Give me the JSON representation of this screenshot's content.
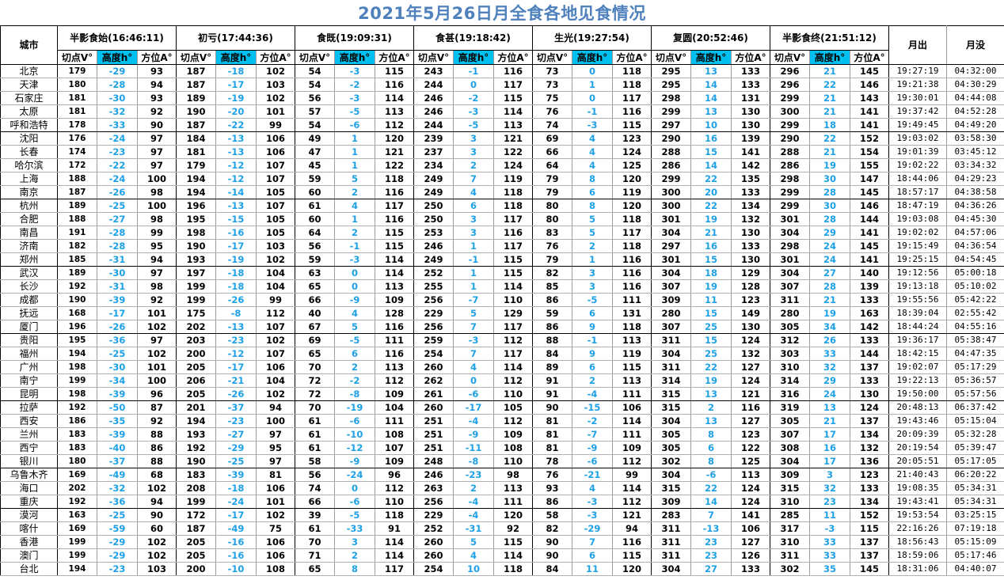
{
  "title": "2021年5月26日月全食各地见食情况",
  "headers": {
    "city": "城市",
    "phases": [
      "半影食始(16:46:11)",
      "初亏(17:44:36)",
      "食既(19:09:31)",
      "食甚(19:18:42)",
      "生光(19:27:54)",
      "复圆(20:52:46)",
      "半影食终(21:51:12)"
    ],
    "sub": [
      "切点V°",
      "高度h°",
      "方位A°"
    ],
    "moonrise": "月出",
    "moonset": "月没"
  },
  "colors": {
    "title": "#4f81bd",
    "height_text": "#1ea0e6",
    "height_header_bg": "#00c0f0"
  },
  "groups": [
    5,
    5,
    5,
    5,
    5,
    5,
    3
  ],
  "rows": [
    {
      "city": "北京",
      "vals": [
        179,
        -29,
        93,
        187,
        -18,
        102,
        54,
        -3,
        115,
        243,
        -1,
        116,
        73,
        0,
        118,
        295,
        13,
        133,
        296,
        21,
        145
      ],
      "rise": "19:27:19",
      "set": "04:32:00"
    },
    {
      "city": "天津",
      "vals": [
        180,
        -28,
        94,
        187,
        -17,
        103,
        54,
        -2,
        116,
        244,
        0,
        117,
        73,
        1,
        118,
        295,
        14,
        133,
        296,
        22,
        146
      ],
      "rise": "19:21:38",
      "set": "04:30:29"
    },
    {
      "city": "石家庄",
      "vals": [
        181,
        -30,
        93,
        189,
        -19,
        102,
        56,
        -3,
        114,
        246,
        -2,
        115,
        75,
        0,
        117,
        298,
        14,
        131,
        299,
        21,
        143
      ],
      "rise": "19:30:01",
      "set": "04:44:08"
    },
    {
      "city": "太原",
      "vals": [
        181,
        -32,
        92,
        190,
        -20,
        101,
        57,
        -5,
        113,
        246,
        -3,
        114,
        76,
        -1,
        116,
        299,
        13,
        130,
        300,
        21,
        141
      ],
      "rise": "19:37:42",
      "set": "04:52:28"
    },
    {
      "city": "呼和浩特",
      "vals": [
        178,
        -33,
        90,
        187,
        -22,
        99,
        54,
        -6,
        112,
        244,
        -5,
        113,
        74,
        -3,
        115,
        297,
        10,
        130,
        299,
        18,
        141
      ],
      "rise": "19:49:45",
      "set": "04:49:20"
    },
    {
      "city": "沈阳",
      "vals": [
        176,
        -24,
        97,
        184,
        -13,
        106,
        49,
        1,
        120,
        239,
        3,
        121,
        69,
        4,
        123,
        290,
        16,
        139,
        290,
        22,
        152
      ],
      "rise": "19:03:02",
      "set": "03:58:30"
    },
    {
      "city": "长春",
      "vals": [
        174,
        -23,
        97,
        181,
        -13,
        106,
        47,
        1,
        121,
        237,
        3,
        122,
        66,
        4,
        124,
        288,
        15,
        141,
        288,
        21,
        154
      ],
      "rise": "19:01:39",
      "set": "03:45:12"
    },
    {
      "city": "哈尔滨",
      "vals": [
        172,
        -22,
        97,
        179,
        -12,
        107,
        45,
        1,
        122,
        234,
        2,
        124,
        64,
        4,
        125,
        286,
        14,
        142,
        286,
        19,
        155
      ],
      "rise": "19:02:22",
      "set": "03:34:32"
    },
    {
      "city": "上海",
      "vals": [
        188,
        -24,
        100,
        194,
        -12,
        107,
        59,
        5,
        118,
        249,
        7,
        119,
        79,
        8,
        120,
        299,
        22,
        135,
        298,
        30,
        147
      ],
      "rise": "18:44:06",
      "set": "04:29:23"
    },
    {
      "city": "南京",
      "vals": [
        187,
        -26,
        98,
        194,
        -14,
        105,
        60,
        2,
        116,
        249,
        4,
        118,
        79,
        6,
        119,
        300,
        20,
        133,
        299,
        28,
        145
      ],
      "rise": "18:57:17",
      "set": "04:38:58"
    },
    {
      "city": "杭州",
      "vals": [
        189,
        -25,
        100,
        196,
        -13,
        107,
        61,
        4,
        117,
        250,
        6,
        118,
        80,
        8,
        120,
        300,
        22,
        134,
        299,
        30,
        146
      ],
      "rise": "18:47:19",
      "set": "04:36:26"
    },
    {
      "city": "合肥",
      "vals": [
        188,
        -27,
        98,
        195,
        -15,
        105,
        60,
        1,
        116,
        250,
        3,
        117,
        80,
        5,
        118,
        301,
        19,
        132,
        301,
        28,
        144
      ],
      "rise": "19:03:08",
      "set": "04:45:30"
    },
    {
      "city": "南昌",
      "vals": [
        191,
        -28,
        99,
        198,
        -16,
        105,
        64,
        2,
        115,
        253,
        3,
        116,
        83,
        5,
        117,
        304,
        21,
        130,
        304,
        29,
        141
      ],
      "rise": "19:02:02",
      "set": "04:57:06"
    },
    {
      "city": "济南",
      "vals": [
        182,
        -28,
        95,
        190,
        -17,
        103,
        56,
        -1,
        115,
        246,
        1,
        117,
        76,
        2,
        118,
        297,
        16,
        133,
        298,
        24,
        145
      ],
      "rise": "19:15:49",
      "set": "04:36:54"
    },
    {
      "city": "郑州",
      "vals": [
        185,
        -31,
        94,
        193,
        -19,
        102,
        59,
        -3,
        114,
        249,
        -1,
        115,
        79,
        1,
        116,
        301,
        15,
        130,
        301,
        24,
        141
      ],
      "rise": "19:25:15",
      "set": "04:54:45"
    },
    {
      "city": "武汉",
      "vals": [
        189,
        -30,
        97,
        197,
        -18,
        104,
        63,
        0,
        114,
        252,
        1,
        115,
        82,
        3,
        116,
        304,
        18,
        129,
        304,
        27,
        140
      ],
      "rise": "19:12:56",
      "set": "05:00:18"
    },
    {
      "city": "长沙",
      "vals": [
        192,
        -31,
        98,
        199,
        -18,
        104,
        65,
        0,
        113,
        255,
        1,
        114,
        85,
        3,
        116,
        307,
        19,
        128,
        307,
        28,
        139
      ],
      "rise": "19:13:18",
      "set": "05:10:02"
    },
    {
      "city": "成都",
      "vals": [
        190,
        -39,
        92,
        199,
        -26,
        99,
        66,
        -9,
        109,
        256,
        -7,
        110,
        86,
        -5,
        111,
        309,
        11,
        123,
        311,
        21,
        133
      ],
      "rise": "19:55:56",
      "set": "05:42:22"
    },
    {
      "city": "抚远",
      "vals": [
        168,
        -17,
        101,
        175,
        -8,
        112,
        40,
        4,
        128,
        229,
        5,
        129,
        59,
        6,
        131,
        280,
        15,
        149,
        280,
        19,
        163
      ],
      "rise": "18:39:04",
      "set": "02:55:42"
    },
    {
      "city": "厦门",
      "vals": [
        196,
        -26,
        102,
        202,
        -13,
        107,
        67,
        5,
        116,
        256,
        7,
        117,
        86,
        9,
        118,
        307,
        25,
        130,
        305,
        34,
        142
      ],
      "rise": "18:44:24",
      "set": "04:55:16"
    },
    {
      "city": "贵阳",
      "vals": [
        195,
        -36,
        97,
        203,
        -23,
        102,
        69,
        -5,
        111,
        259,
        -3,
        112,
        88,
        -1,
        113,
        311,
        15,
        124,
        312,
        26,
        133
      ],
      "rise": "19:36:17",
      "set": "05:38:47"
    },
    {
      "city": "福州",
      "vals": [
        194,
        -25,
        102,
        200,
        -12,
        107,
        65,
        6,
        116,
        254,
        7,
        117,
        84,
        9,
        119,
        304,
        25,
        132,
        303,
        33,
        144
      ],
      "rise": "18:42:15",
      "set": "04:47:35"
    },
    {
      "city": "广州",
      "vals": [
        198,
        -30,
        101,
        205,
        -17,
        106,
        70,
        2,
        113,
        260,
        4,
        114,
        89,
        6,
        115,
        311,
        22,
        127,
        310,
        32,
        137
      ],
      "rise": "19:02:07",
      "set": "05:17:29"
    },
    {
      "city": "南宁",
      "vals": [
        199,
        -34,
        100,
        206,
        -21,
        104,
        72,
        -2,
        112,
        262,
        0,
        112,
        91,
        2,
        113,
        314,
        19,
        124,
        314,
        29,
        133
      ],
      "rise": "19:22:13",
      "set": "05:36:57"
    },
    {
      "city": "昆明",
      "vals": [
        198,
        -39,
        96,
        205,
        -26,
        102,
        72,
        -8,
        109,
        261,
        -6,
        110,
        91,
        -4,
        111,
        315,
        13,
        121,
        316,
        24,
        130
      ],
      "rise": "19:50:00",
      "set": "05:57:56"
    },
    {
      "city": "拉萨",
      "vals": [
        192,
        -50,
        87,
        201,
        -37,
        94,
        70,
        -19,
        104,
        260,
        -17,
        105,
        90,
        -15,
        106,
        315,
        2,
        116,
        319,
        13,
        124
      ],
      "rise": "20:48:13",
      "set": "06:37:42"
    },
    {
      "city": "西安",
      "vals": [
        186,
        -35,
        92,
        194,
        -23,
        100,
        61,
        -6,
        111,
        251,
        -4,
        112,
        81,
        -2,
        114,
        304,
        13,
        127,
        305,
        21,
        137
      ],
      "rise": "19:43:46",
      "set": "05:15:04"
    },
    {
      "city": "兰州",
      "vals": [
        183,
        -39,
        88,
        193,
        -27,
        97,
        61,
        -10,
        108,
        251,
        -9,
        109,
        81,
        -7,
        111,
        305,
        8,
        123,
        307,
        17,
        134
      ],
      "rise": "20:09:39",
      "set": "05:32:28"
    },
    {
      "city": "西宁",
      "vals": [
        183,
        -40,
        86,
        192,
        -29,
        95,
        61,
        -12,
        107,
        251,
        -11,
        108,
        81,
        -9,
        109,
        305,
        6,
        122,
        308,
        16,
        132
      ],
      "rise": "20:19:54",
      "set": "05:39:47"
    },
    {
      "city": "银川",
      "vals": [
        180,
        -37,
        88,
        190,
        -25,
        97,
        58,
        -9,
        109,
        248,
        -8,
        110,
        78,
        -6,
        112,
        302,
        8,
        125,
        304,
        17,
        136
      ],
      "rise": "20:05:51",
      "set": "05:17:05"
    },
    {
      "city": "乌鲁木齐",
      "vals": [
        169,
        -49,
        68,
        183,
        -39,
        81,
        56,
        -24,
        96,
        246,
        -23,
        98,
        76,
        -21,
        99,
        304,
        -6,
        113,
        309,
        3,
        123
      ],
      "rise": "21:40:43",
      "set": "06:20:22"
    },
    {
      "city": "海口",
      "vals": [
        202,
        -32,
        102,
        208,
        -18,
        106,
        74,
        0,
        112,
        263,
        2,
        113,
        93,
        4,
        114,
        315,
        22,
        124,
        315,
        32,
        133
      ],
      "rise": "19:08:35",
      "set": "05:34:31"
    },
    {
      "city": "重庆",
      "vals": [
        192,
        -36,
        94,
        199,
        -24,
        101,
        66,
        -6,
        110,
        256,
        -4,
        111,
        86,
        -3,
        112,
        309,
        14,
        124,
        310,
        23,
        134
      ],
      "rise": "19:43:41",
      "set": "05:34:31"
    },
    {
      "city": "漠河",
      "vals": [
        163,
        -25,
        90,
        172,
        -17,
        102,
        39,
        -5,
        118,
        229,
        -4,
        120,
        58,
        -3,
        121,
        283,
        7,
        141,
        285,
        11,
        152
      ],
      "rise": "19:53:54",
      "set": "03:25:15"
    },
    {
      "city": "喀什",
      "vals": [
        169,
        -59,
        60,
        187,
        -49,
        75,
        61,
        -33,
        91,
        252,
        -31,
        92,
        82,
        -29,
        94,
        311,
        -13,
        106,
        317,
        -3,
        115
      ],
      "rise": "22:16:26",
      "set": "07:19:18"
    },
    {
      "city": "香港",
      "vals": [
        199,
        -29,
        102,
        205,
        -16,
        106,
        70,
        3,
        114,
        260,
        5,
        115,
        90,
        7,
        116,
        311,
        23,
        127,
        310,
        33,
        137
      ],
      "rise": "18:56:43",
      "set": "05:15:09"
    },
    {
      "city": "澳门",
      "vals": [
        199,
        -29,
        102,
        205,
        -16,
        106,
        71,
        2,
        114,
        260,
        4,
        114,
        90,
        6,
        115,
        311,
        23,
        126,
        311,
        33,
        137
      ],
      "rise": "18:59:06",
      "set": "05:17:46"
    },
    {
      "city": "台北",
      "vals": [
        194,
        -23,
        103,
        200,
        -10,
        108,
        65,
        8,
        117,
        254,
        10,
        118,
        84,
        11,
        120,
        304,
        27,
        133,
        302,
        35,
        145
      ],
      "rise": "18:31:06",
      "set": "04:40:07"
    }
  ]
}
